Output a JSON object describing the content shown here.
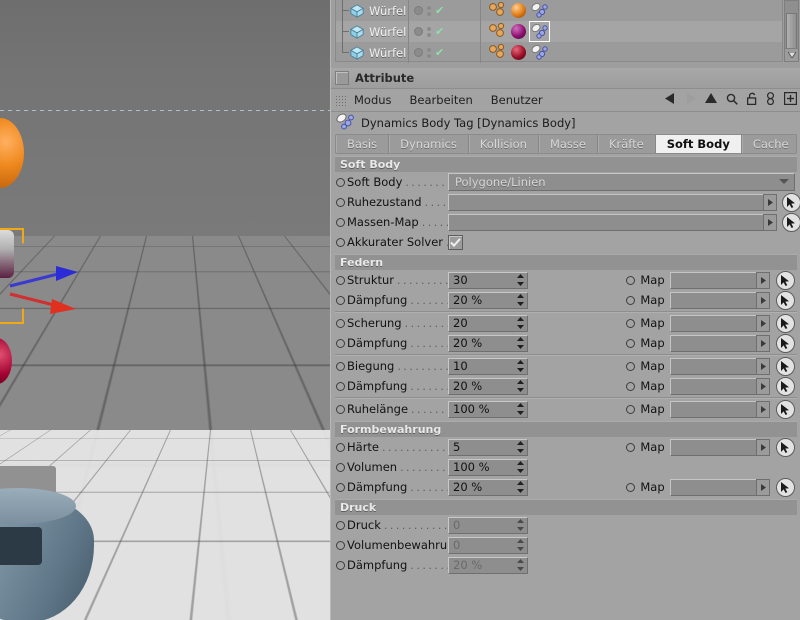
{
  "object_manager": {
    "rows": [
      {
        "name": "Würfel",
        "material_color": "#e07a14",
        "selected": false
      },
      {
        "name": "Würfel",
        "material_color": "#8e1070",
        "selected": true
      },
      {
        "name": "Würfel",
        "material_color": "#9c1028",
        "selected": false
      }
    ],
    "icons": {
      "cube": "cube-icon",
      "visible_dot": "visibility-dot-icon",
      "check": "✔",
      "tag": "dynamics-body-tag-icon"
    }
  },
  "attribute": {
    "title": "Attribute",
    "menu": [
      "Modus",
      "Bearbeiten",
      "Benutzer"
    ],
    "toolbar_icons": [
      "back-arrow-icon",
      "forward-arrow-icon",
      "up-arrow-icon",
      "search-icon",
      "unlock-icon",
      "link-icon",
      "add-icon"
    ],
    "tag_header": "Dynamics Body Tag [Dynamics Body]",
    "tabs": [
      {
        "label": "Basis",
        "active": false
      },
      {
        "label": "Dynamics",
        "active": false
      },
      {
        "label": "Kollision",
        "active": false
      },
      {
        "label": "Masse",
        "active": false
      },
      {
        "label": "Kräfte",
        "active": false
      },
      {
        "label": "Soft Body",
        "active": true
      },
      {
        "label": "Cache",
        "active": false
      }
    ],
    "sections": [
      {
        "title": "Soft Body",
        "rows": [
          {
            "label": "Soft Body",
            "type": "dropdown",
            "value": "Polygone/Linien"
          },
          {
            "label": "Ruhezustand",
            "type": "link",
            "value": ""
          },
          {
            "label": "Massen-Map",
            "type": "link",
            "value": ""
          },
          {
            "label": "Akkurater Solver",
            "type": "checkbox",
            "checked": true
          }
        ]
      },
      {
        "title": "Federn",
        "groups": [
          [
            {
              "label": "Struktur",
              "value": "30",
              "map": "Map",
              "disabled": false
            },
            {
              "label": "Dämpfung",
              "value": "20 %",
              "map": "Map",
              "disabled": false
            }
          ],
          [
            {
              "label": "Scherung",
              "value": "20",
              "map": "Map",
              "disabled": false
            },
            {
              "label": "Dämpfung",
              "value": "20 %",
              "map": "Map",
              "disabled": false
            }
          ],
          [
            {
              "label": "Biegung",
              "value": "10",
              "map": "Map",
              "disabled": false
            },
            {
              "label": "Dämpfung",
              "value": "20 %",
              "map": "Map",
              "disabled": false
            }
          ],
          [
            {
              "label": "Ruhelänge",
              "value": "100 %",
              "map": "Map",
              "disabled": false
            }
          ]
        ]
      },
      {
        "title": "Formbewahrung",
        "groups": [
          [
            {
              "label": "Härte",
              "value": "5",
              "map": "Map",
              "disabled": false
            },
            {
              "label": "Volumen",
              "value": "100 %",
              "map": null,
              "disabled": false
            },
            {
              "label": "Dämpfung",
              "value": "20 %",
              "map": "Map",
              "disabled": false
            }
          ]
        ]
      },
      {
        "title": "Druck",
        "groups": [
          [
            {
              "label": "Druck",
              "value": "0",
              "map": null,
              "disabled": true
            },
            {
              "label": "Volumenbewahrung",
              "value": "0",
              "map": null,
              "disabled": true
            },
            {
              "label": "Dämpfung",
              "value": "20 %",
              "map": null,
              "disabled": true
            }
          ]
        ]
      }
    ]
  },
  "viewport": {
    "name": "3d-viewport",
    "axis_colors": {
      "x": "#d02020",
      "z": "#2030d0",
      "selection": "#f0a814"
    }
  }
}
